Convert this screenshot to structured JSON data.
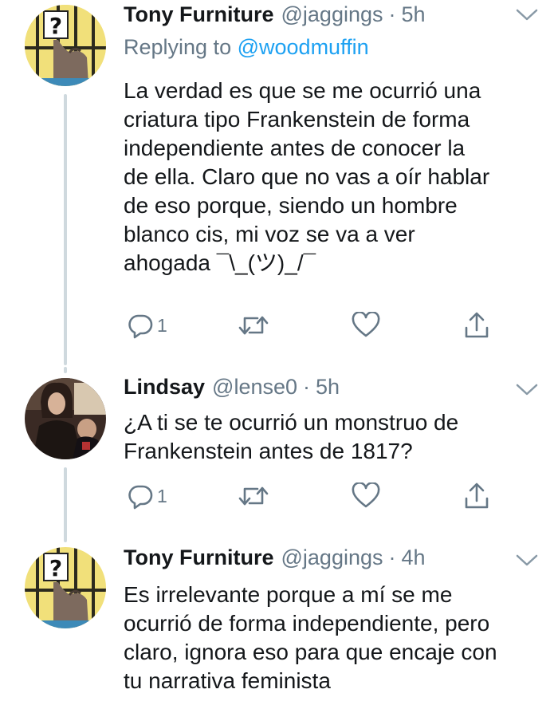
{
  "tweets": [
    {
      "name": "Tony Furniture",
      "handle": "@jaggings",
      "dot": "·",
      "time": "5h",
      "reply_prefix": "Replying to",
      "reply_target": "@woodmuffin",
      "text": "La verdad es que se me ocurrió una\ncriatura tipo Frankenstein de forma\nindependiente antes de conocer la\nde ella. Claro que no vas a oír hablar\nde eso porque, siendo un hombre\nblanco cis, mi voz se va a ver\nahogada ¯\\_(ツ)_/¯",
      "reply_count": "1",
      "avatar": "cartoon-character-avatar"
    },
    {
      "name": "Lindsay",
      "handle": "@lense0",
      "dot": "·",
      "time": "5h",
      "text": "¿A ti se te ocurrió un monstruo de\nFrankenstein antes de 1817?",
      "reply_count": "1",
      "avatar": "photo-avatar"
    },
    {
      "name": "Tony Furniture",
      "handle": "@jaggings",
      "dot": "·",
      "time": "4h",
      "text": "Es irrelevante porque a mí se me\nocurrió de forma independiente, pero\nclaro, ignora eso para que encaje con\ntu narrativa feminista",
      "avatar": "cartoon-character-avatar"
    }
  ],
  "icons": {
    "reply": "reply-icon",
    "retweet": "retweet-icon",
    "like": "like-icon",
    "share": "share-icon",
    "more": "chevron-down-icon"
  },
  "colors": {
    "text": "#14171a",
    "secondary": "#657786",
    "link": "#1da1f2",
    "thread": "#cfd9de"
  }
}
